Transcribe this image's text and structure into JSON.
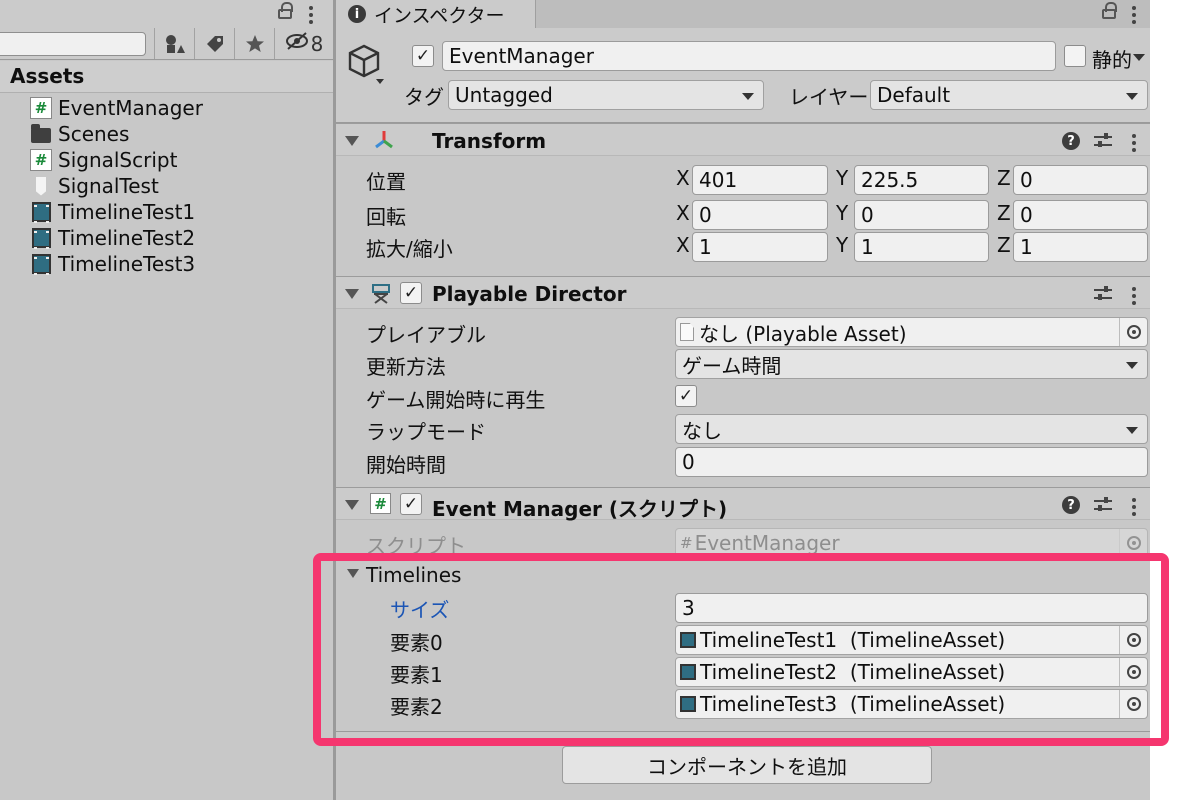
{
  "project": {
    "filter_count": "8",
    "assets_header": "Assets",
    "items": [
      {
        "label": "EventManager",
        "icon": "script-icon"
      },
      {
        "label": "Scenes",
        "icon": "folder-icon"
      },
      {
        "label": "SignalScript",
        "icon": "script-icon"
      },
      {
        "label": "SignalTest",
        "icon": "signal-icon"
      },
      {
        "label": "TimelineTest1",
        "icon": "timeline-icon"
      },
      {
        "label": "TimelineTest2",
        "icon": "timeline-icon"
      },
      {
        "label": "TimelineTest3",
        "icon": "timeline-icon"
      }
    ]
  },
  "inspector": {
    "tab_label": "インスペクター",
    "object_name": "EventManager",
    "static_label": "静的",
    "tag_label": "タグ",
    "tag_value": "Untagged",
    "layer_label": "レイヤー",
    "layer_value": "Default"
  },
  "transform": {
    "title": "Transform",
    "rows": [
      {
        "label": "位置",
        "x": "401",
        "y": "225.5",
        "z": "0"
      },
      {
        "label": "回転",
        "x": "0",
        "y": "0",
        "z": "0"
      },
      {
        "label": "拡大/縮小",
        "x": "1",
        "y": "1",
        "z": "1"
      }
    ],
    "axis_x": "X",
    "axis_y": "Y",
    "axis_z": "Z"
  },
  "playable_director": {
    "title": "Playable Director",
    "playable_label": "プレイアブル",
    "playable_value": "なし (Playable Asset)",
    "update_label": "更新方法",
    "update_value": "ゲーム時間",
    "play_on_awake_label": "ゲーム開始時に再生",
    "wrap_label": "ラップモード",
    "wrap_value": "なし",
    "initial_time_label": "開始時間",
    "initial_time_value": "0"
  },
  "event_manager": {
    "title": "Event Manager (スクリプト)",
    "script_label": "スクリプト",
    "script_value": "EventManager",
    "timelines_label": "Timelines",
    "size_label": "サイズ",
    "size_value": "3",
    "elements": [
      {
        "label": "要素0",
        "value": "TimelineTest1  (TimelineAsset)"
      },
      {
        "label": "要素1",
        "value": "TimelineTest2  (TimelineAsset)"
      },
      {
        "label": "要素2",
        "value": "TimelineTest3  (TimelineAsset)"
      }
    ]
  },
  "add_component_label": "コンポーネントを追加",
  "colors": {
    "highlight": "#f5366f",
    "size_label": "#1b55b5"
  }
}
